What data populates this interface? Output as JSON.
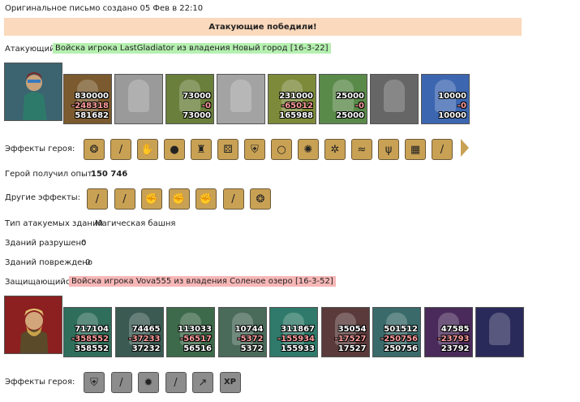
{
  "header": {
    "created_line": "Оригинальное письмо создано 05 Фев в 22:10"
  },
  "result": {
    "banner": "Атакующие победили!"
  },
  "attacker": {
    "label": "Атакующий",
    "name": "Войска игрока LastGladiator из владения Новый город [16-3-22]",
    "name_bg": "#b5f0b0",
    "units": [
      {
        "n1": "830000",
        "n2": "-248318",
        "n3": "581682",
        "bg": "#7a5a2e"
      },
      {
        "n1": "",
        "n2": "",
        "n3": "",
        "bg": "#9a9a9a"
      },
      {
        "n1": "73000",
        "n2": "-0",
        "n3": "73000",
        "bg": "#6a7f3c"
      },
      {
        "n1": "",
        "n2": "",
        "n3": "",
        "bg": "#a3a3a3"
      },
      {
        "n1": "231000",
        "n2": "-65012",
        "n3": "165988",
        "bg": "#7d8a3a"
      },
      {
        "n1": "25000",
        "n2": "-0",
        "n3": "25000",
        "bg": "#5a8a4a"
      },
      {
        "n1": "",
        "n2": "",
        "n3": "",
        "bg": "#666666"
      },
      {
        "n1": "10000",
        "n2": "-0",
        "n3": "10000",
        "bg": "#3c66b0"
      }
    ]
  },
  "hero_effects": {
    "label": "Эффекты героя:",
    "icons": [
      "shield-bag-icon",
      "sword-icon",
      "handshake-icon",
      "hand-orb-icon",
      "castle-icon",
      "dice-icon",
      "shield-icon",
      "hand-ring-icon",
      "web-icon",
      "crab-icon",
      "dragon-icon",
      "wings-icon",
      "gate-icon",
      "sword-icon"
    ]
  },
  "experience": {
    "label": "Герой получил опыт:",
    "value": "150 746"
  },
  "other_effects": {
    "label": "Другие эффекты:",
    "icons": [
      "sword-icon",
      "sword-icon",
      "fist-icon",
      "fist-icon",
      "fist-icon",
      "sword-icon",
      "shield-bag-icon"
    ]
  },
  "buildings": {
    "type_label": "Тип атакуемых зданий",
    "type_value": "Магическая башня",
    "destroyed_label": "Зданий разрушено",
    "destroyed_value": "0",
    "damaged_label": "Зданий повреждено",
    "damaged_value": "0"
  },
  "defender": {
    "label": "Защищающийся",
    "name": "Войска игрока Vova555 из владения Соленое озеро [16-3-52]",
    "name_bg": "#f7b7b7",
    "units": [
      {
        "n1": "717104",
        "n2": "-358552",
        "n3": "358552",
        "bg": "#2f6e5a"
      },
      {
        "n1": "74465",
        "n2": "-37233",
        "n3": "37232",
        "bg": "#3a5a52"
      },
      {
        "n1": "113033",
        "n2": "-56517",
        "n3": "56516",
        "bg": "#3d6a4a"
      },
      {
        "n1": "10744",
        "n2": "-5372",
        "n3": "5372",
        "bg": "#4a6a5a"
      },
      {
        "n1": "311867",
        "n2": "-155934",
        "n3": "155933",
        "bg": "#2f7a6a"
      },
      {
        "n1": "35054",
        "n2": "-17527",
        "n3": "17527",
        "bg": "#5a3a3a"
      },
      {
        "n1": "501512",
        "n2": "-250756",
        "n3": "250756",
        "bg": "#3a6a6a"
      },
      {
        "n1": "47585",
        "n2": "-23793",
        "n3": "23792",
        "bg": "#4a2a5a"
      },
      {
        "n1": "",
        "n2": "",
        "n3": "",
        "bg": "#2a2a5a"
      }
    ]
  },
  "defender_effects": {
    "label": "Эффекты героя:",
    "icons": [
      "shield-icon",
      "sword-icon",
      "gear-icon",
      "sword-icon",
      "arrows-icon",
      "xp-icon"
    ]
  },
  "glyphs": {
    "shield-bag-icon": "❂",
    "sword-icon": "/",
    "handshake-icon": "✋",
    "hand-orb-icon": "●",
    "castle-icon": "♜",
    "dice-icon": "⚄",
    "shield-icon": "⛨",
    "hand-ring-icon": "○",
    "web-icon": "✺",
    "crab-icon": "✲",
    "dragon-icon": "≈",
    "wings-icon": "ψ",
    "gate-icon": "▦",
    "fist-icon": "✊",
    "gear-icon": "✹",
    "arrows-icon": "↗",
    "xp-icon": "XP"
  }
}
